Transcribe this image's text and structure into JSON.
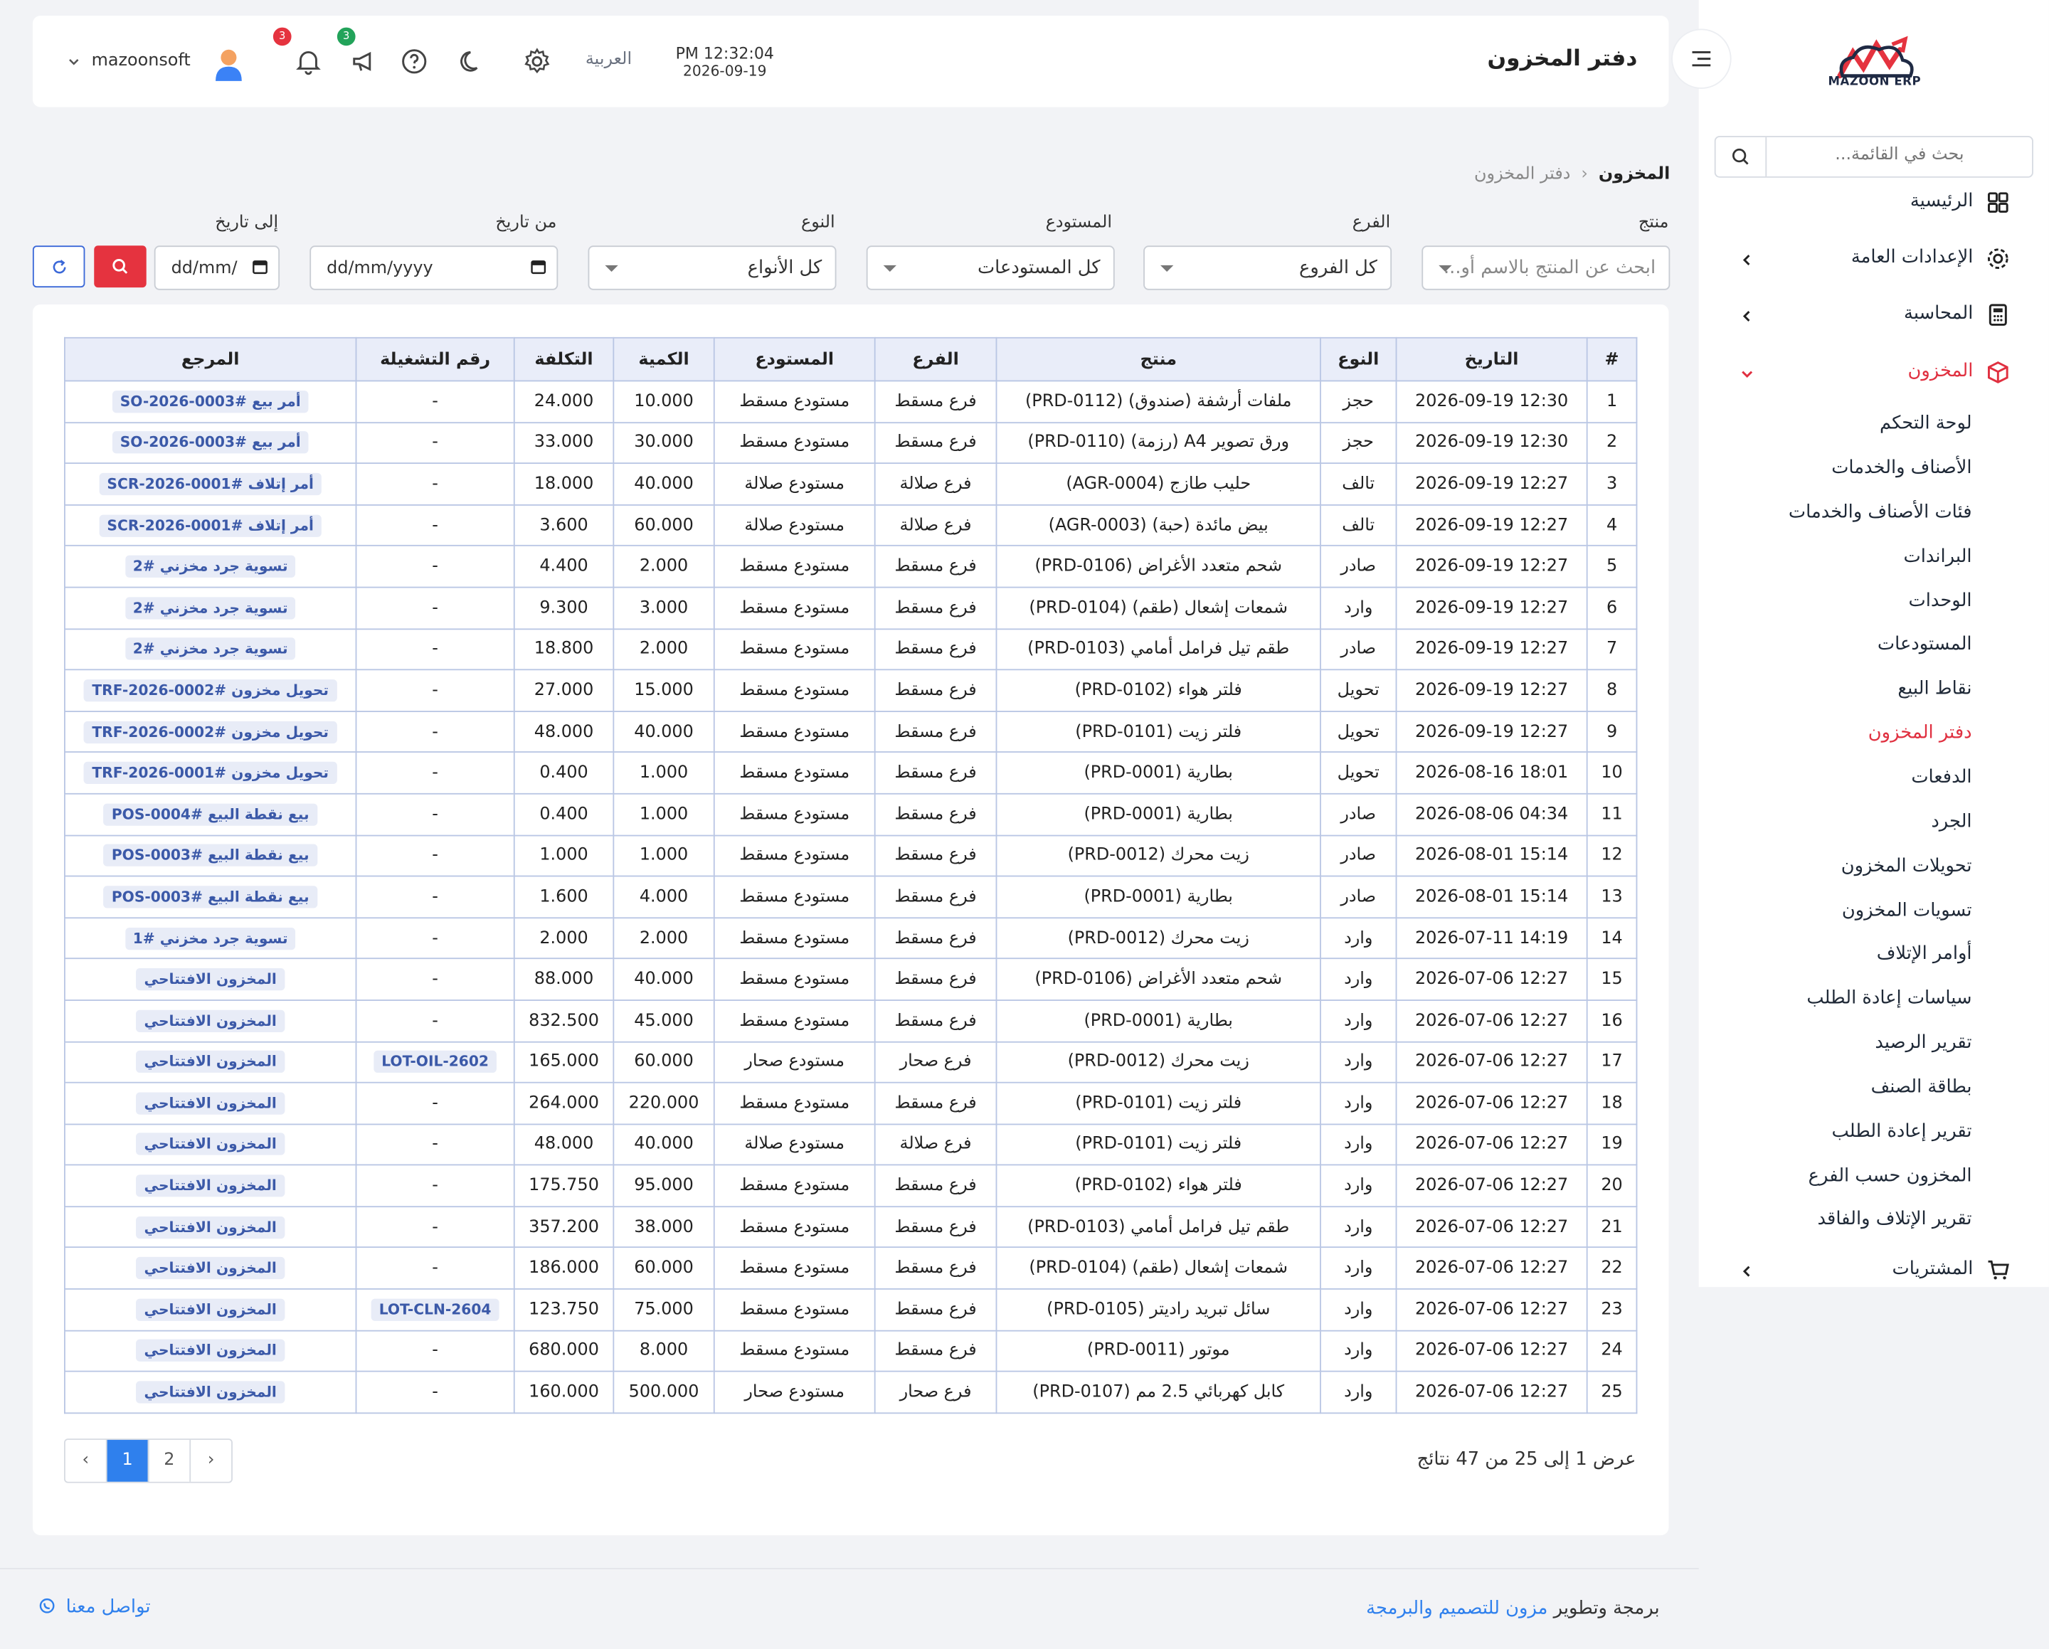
{
  "app": {
    "logo_text": "MAZOON ERP",
    "logo_subtext": "ERPERP"
  },
  "sidebar": {
    "search_placeholder": "بحث في القائمة...",
    "top_items": [
      {
        "label": "الرئيسية",
        "icon": "grid-icon"
      },
      {
        "label": "الإعدادات العامة",
        "icon": "gear-icon"
      },
      {
        "label": "المحاسبة",
        "icon": "calculator-icon"
      },
      {
        "label": "المخزون",
        "icon": "box-icon"
      }
    ],
    "sub_items": [
      "لوحة التحكم",
      "الأصناف والخدمات",
      "فئات الأصناف والخدمات",
      "البراندات",
      "الوحدات",
      "المستودعات",
      "نقاط البيع",
      "دفتر المخزون",
      "الدفعات",
      "الجرد",
      "تحويلات المخزون",
      "تسويات المخزون",
      "أوامر الإتلاف",
      "سياسات إعادة الطلب",
      "تقرير الرصيد",
      "بطاقة الصنف",
      "تقرير إعادة الطلب",
      "المخزون حسب الفرع",
      "تقرير الإتلاف والفاقد"
    ],
    "active_sub": "دفتر المخزون",
    "bottom_item": {
      "label": "المشتريات",
      "icon": "cart-icon"
    }
  },
  "topbar": {
    "title": "دفتر المخزون",
    "time": "PM 12:32:04",
    "date": "2026-09-19",
    "language": "العربية",
    "notifications_count": "3",
    "announcements_count": "3",
    "username": "mazoonsoft"
  },
  "breadcrumb": {
    "root": "المخزون",
    "current": "دفتر المخزون"
  },
  "filters": {
    "product_label": "منتج",
    "product_placeholder": "ابحث عن المنتج بالاسم أو...",
    "branch_label": "الفرع",
    "branch_value": "كل الفروع",
    "warehouse_label": "المستودع",
    "warehouse_value": "كل المستودعات",
    "type_label": "النوع",
    "type_value": "كل الأنواع",
    "from_label": "من تاريخ",
    "from_placeholder": "dd/mm/yyyy",
    "to_label": "إلى تاريخ",
    "to_placeholder": "dd/mm/"
  },
  "table": {
    "headers": [
      "#",
      "التاريخ",
      "النوع",
      "منتج",
      "الفرع",
      "المستودع",
      "الكمية",
      "التكلفة",
      "رقم التشغيلة",
      "المرجع"
    ],
    "rows": [
      [
        "1",
        "2026-09-19 12:30",
        "حجز",
        "ملفات أرشفة (صندوق) (PRD-0112)",
        "فرع مسقط",
        "مستودع مسقط",
        "10.000",
        "24.000",
        "-",
        "أمر بيع #SO-2026-0003"
      ],
      [
        "2",
        "2026-09-19 12:30",
        "حجز",
        "ورق تصوير A4 (رزمة) (PRD-0110)",
        "فرع مسقط",
        "مستودع مسقط",
        "30.000",
        "33.000",
        "-",
        "أمر بيع #SO-2026-0003"
      ],
      [
        "3",
        "2026-09-19 12:27",
        "تالف",
        "حليب طازج (AGR-0004)",
        "فرع صلالة",
        "مستودع صلالة",
        "40.000",
        "18.000",
        "-",
        "أمر إتلاف #SCR-2026-0001"
      ],
      [
        "4",
        "2026-09-19 12:27",
        "تالف",
        "بيض مائدة (حبة) (AGR-0003)",
        "فرع صلالة",
        "مستودع صلالة",
        "60.000",
        "3.600",
        "-",
        "أمر إتلاف #SCR-2026-0001"
      ],
      [
        "5",
        "2026-09-19 12:27",
        "صادر",
        "شحم متعدد الأغراض (PRD-0106)",
        "فرع مسقط",
        "مستودع مسقط",
        "2.000",
        "4.400",
        "-",
        "تسوية جرد مخزني #2"
      ],
      [
        "6",
        "2026-09-19 12:27",
        "وارد",
        "شمعات إشعال (طقم) (PRD-0104)",
        "فرع مسقط",
        "مستودع مسقط",
        "3.000",
        "9.300",
        "-",
        "تسوية جرد مخزني #2"
      ],
      [
        "7",
        "2026-09-19 12:27",
        "صادر",
        "طقم تيل فرامل أمامي (PRD-0103)",
        "فرع مسقط",
        "مستودع مسقط",
        "2.000",
        "18.800",
        "-",
        "تسوية جرد مخزني #2"
      ],
      [
        "8",
        "2026-09-19 12:27",
        "تحويل",
        "فلتر هواء (PRD-0102)",
        "فرع مسقط",
        "مستودع مسقط",
        "15.000",
        "27.000",
        "-",
        "تحويل مخزون #TRF-2026-0002"
      ],
      [
        "9",
        "2026-09-19 12:27",
        "تحويل",
        "فلتر زيت (PRD-0101)",
        "فرع مسقط",
        "مستودع مسقط",
        "40.000",
        "48.000",
        "-",
        "تحويل مخزون #TRF-2026-0002"
      ],
      [
        "10",
        "2026-08-16 18:01",
        "تحويل",
        "بطارية (PRD-0001)",
        "فرع مسقط",
        "مستودع مسقط",
        "1.000",
        "0.400",
        "-",
        "تحويل مخزون #TRF-2026-0001"
      ],
      [
        "11",
        "2026-08-06 04:34",
        "صادر",
        "بطارية (PRD-0001)",
        "فرع مسقط",
        "مستودع مسقط",
        "1.000",
        "0.400",
        "-",
        "بيع نقطة البيع #POS-0004"
      ],
      [
        "12",
        "2026-08-01 15:14",
        "صادر",
        "زيت محرك (PRD-0012)",
        "فرع مسقط",
        "مستودع مسقط",
        "1.000",
        "1.000",
        "-",
        "بيع نقطة البيع #POS-0003"
      ],
      [
        "13",
        "2026-08-01 15:14",
        "صادر",
        "بطارية (PRD-0001)",
        "فرع مسقط",
        "مستودع مسقط",
        "4.000",
        "1.600",
        "-",
        "بيع نقطة البيع #POS-0003"
      ],
      [
        "14",
        "2026-07-11 14:19",
        "وارد",
        "زيت محرك (PRD-0012)",
        "فرع مسقط",
        "مستودع مسقط",
        "2.000",
        "2.000",
        "-",
        "تسوية جرد مخزني #1"
      ],
      [
        "15",
        "2026-07-06 12:27",
        "وارد",
        "شحم متعدد الأغراض (PRD-0106)",
        "فرع مسقط",
        "مستودع مسقط",
        "40.000",
        "88.000",
        "-",
        "المخزون الافتتاحي"
      ],
      [
        "16",
        "2026-07-06 12:27",
        "وارد",
        "بطارية (PRD-0001)",
        "فرع مسقط",
        "مستودع مسقط",
        "45.000",
        "832.500",
        "-",
        "المخزون الافتتاحي"
      ],
      [
        "17",
        "2026-07-06 12:27",
        "وارد",
        "زيت محرك (PRD-0012)",
        "فرع صحار",
        "مستودع صحار",
        "60.000",
        "165.000",
        "LOT-OIL-2602",
        "المخزون الافتتاحي"
      ],
      [
        "18",
        "2026-07-06 12:27",
        "وارد",
        "فلتر زيت (PRD-0101)",
        "فرع مسقط",
        "مستودع مسقط",
        "220.000",
        "264.000",
        "-",
        "المخزون الافتتاحي"
      ],
      [
        "19",
        "2026-07-06 12:27",
        "وارد",
        "فلتر زيت (PRD-0101)",
        "فرع صلالة",
        "مستودع صلالة",
        "40.000",
        "48.000",
        "-",
        "المخزون الافتتاحي"
      ],
      [
        "20",
        "2026-07-06 12:27",
        "وارد",
        "فلتر هواء (PRD-0102)",
        "فرع مسقط",
        "مستودع مسقط",
        "95.000",
        "175.750",
        "-",
        "المخزون الافتتاحي"
      ],
      [
        "21",
        "2026-07-06 12:27",
        "وارد",
        "طقم تيل فرامل أمامي (PRD-0103)",
        "فرع مسقط",
        "مستودع مسقط",
        "38.000",
        "357.200",
        "-",
        "المخزون الافتتاحي"
      ],
      [
        "22",
        "2026-07-06 12:27",
        "وارد",
        "شمعات إشعال (طقم) (PRD-0104)",
        "فرع مسقط",
        "مستودع مسقط",
        "60.000",
        "186.000",
        "-",
        "المخزون الافتتاحي"
      ],
      [
        "23",
        "2026-07-06 12:27",
        "وارد",
        "سائل تبريد راديتر (PRD-0105)",
        "فرع مسقط",
        "مستودع مسقط",
        "75.000",
        "123.750",
        "LOT-CLN-2604",
        "المخزون الافتتاحي"
      ],
      [
        "24",
        "2026-07-06 12:27",
        "وارد",
        "موتور (PRD-0011)",
        "فرع مسقط",
        "مستودع مسقط",
        "8.000",
        "680.000",
        "-",
        "المخزون الافتتاحي"
      ],
      [
        "25",
        "2026-07-06 12:27",
        "وارد",
        "كابل كهربائي 2.5 مم (PRD-0107)",
        "فرع صحار",
        "مستودع صحار",
        "500.000",
        "160.000",
        "-",
        "المخزون الافتتاحي"
      ]
    ]
  },
  "pagination": {
    "info": "عرض 1 إلى 25 من 47 نتائج",
    "prev": "‹",
    "pages": [
      "1",
      "2"
    ],
    "next": "›"
  },
  "footer": {
    "credit_prefix": "برمجة وتطوير",
    "credit_link": "مزون للتصميم والبرمجة",
    "contact": "تواصل معنا"
  },
  "colors": {
    "accent_red": "#e5333f",
    "primary_blue": "#2f80ed",
    "header_bg": "#e9edf9"
  }
}
